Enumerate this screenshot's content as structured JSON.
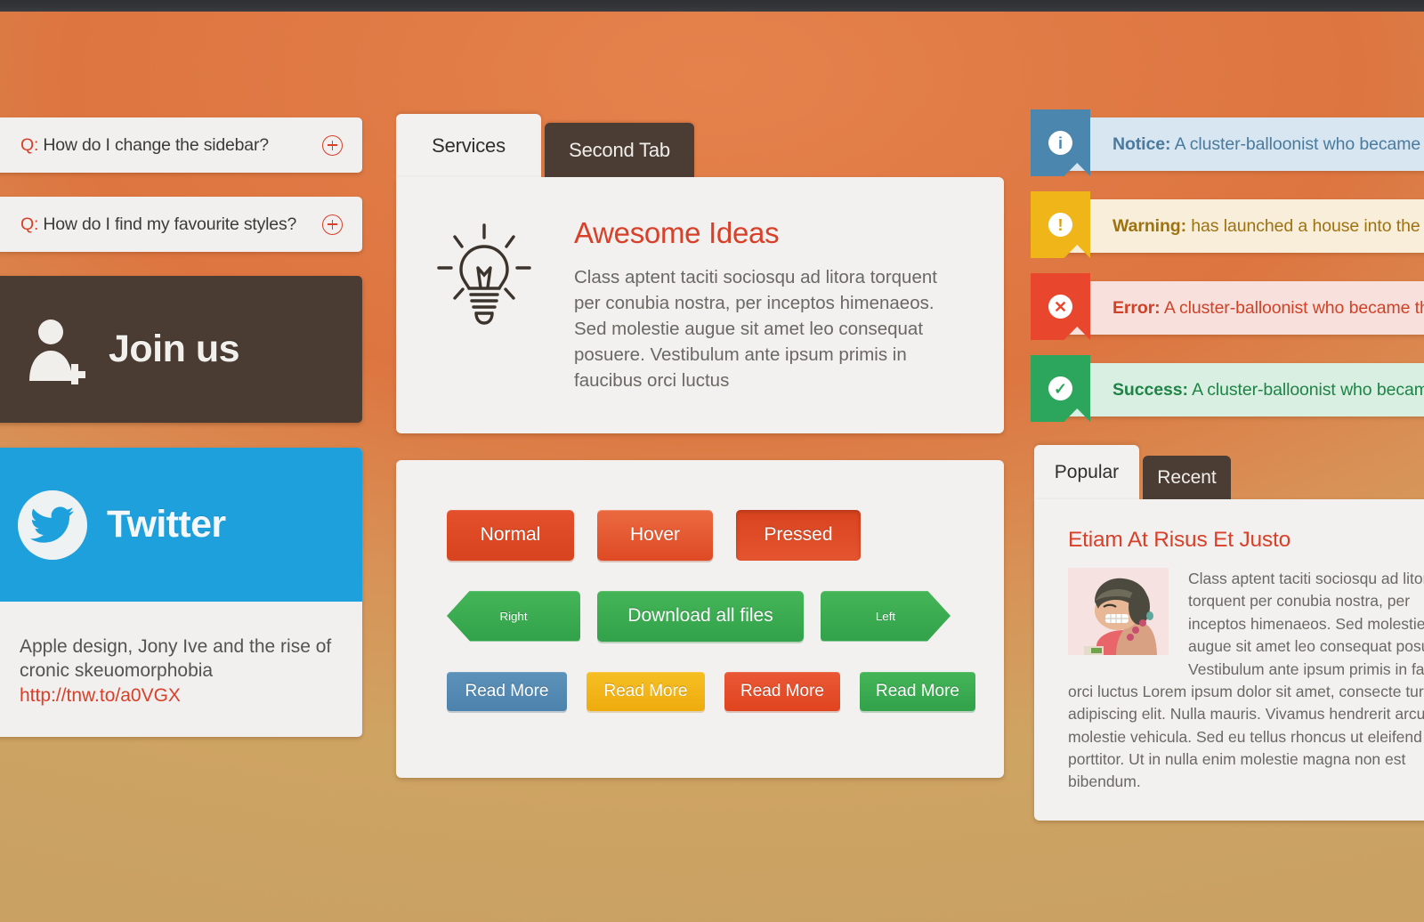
{
  "theme": {
    "accent_red": "#d8402a",
    "dark_brown": "#4a3c33",
    "twitter_blue": "#1da0dc",
    "panel_bg": "#f2f1ef",
    "blue": "#4a86ae",
    "yellow": "#f0b518",
    "red": "#e8472e",
    "green": "#2ca65c"
  },
  "faq": {
    "items": [
      {
        "prefix": "Q:",
        "question": " How do I change the sidebar?",
        "toggle_icon": "plus-circle-icon"
      },
      {
        "prefix": "Q:",
        "question": " How do I find my favourite styles?",
        "toggle_icon": "plus-circle-icon"
      }
    ]
  },
  "join_us": {
    "label": "Join us",
    "icon": "user-add-icon"
  },
  "twitter": {
    "label": "Twitter",
    "icon": "twitter-bird-icon",
    "tweet": "Apple design, Jony Ive and the rise of cronic skeuomorphobia",
    "link": "http://tnw.to/a0VGX"
  },
  "services": {
    "tabs": [
      {
        "label": "Services",
        "active": true
      },
      {
        "label": "Second Tab",
        "active": false
      }
    ],
    "icon": "lightbulb-icon",
    "title": "Awesome Ideas",
    "body": "Class aptent taciti sociosqu ad litora torquent per conubia nostra, per inceptos himenaeos. Sed molestie augue sit amet leo consequat posuere. Vestibulum ante ipsum primis in faucibus orci luctus"
  },
  "buttons": {
    "row1": [
      {
        "label": "Normal",
        "state": "normal",
        "color": "#d8431f"
      },
      {
        "label": "Hover",
        "state": "hover",
        "color": "#de4a24"
      },
      {
        "label": "Pressed",
        "state": "pressed",
        "color": "#d8431f"
      }
    ],
    "row2": [
      {
        "label": "Right",
        "shape": "arrow-left-ribbon",
        "color": "#32a24b"
      },
      {
        "label": "Download all files",
        "shape": "rounded",
        "color": "#32a24b"
      },
      {
        "label": "Left",
        "shape": "arrow-right-ribbon",
        "color": "#32a24b"
      }
    ],
    "row3": [
      {
        "label": "Read More",
        "color": "#4c82ac"
      },
      {
        "label": "Read More",
        "color": "#eeab0d"
      },
      {
        "label": "Read More",
        "color": "#e0441f"
      },
      {
        "label": "Read More",
        "color": "#32a24b"
      }
    ]
  },
  "alerts": [
    {
      "type": "notice",
      "icon": "info-icon",
      "glyph": "i",
      "title": "Notice:",
      "message": " A cluster-balloonist who became th"
    },
    {
      "type": "warning",
      "icon": "warning-icon",
      "glyph": "!",
      "title": "Warning:",
      "message": " has launched a house into the sky"
    },
    {
      "type": "error",
      "icon": "error-icon",
      "glyph": "✕",
      "title": "Error:",
      "message": " A cluster-balloonist who became the f"
    },
    {
      "type": "success",
      "icon": "check-icon",
      "glyph": "✓",
      "title": "Success:",
      "message": " A cluster-balloonist who became th"
    }
  ],
  "popular": {
    "tabs": [
      {
        "label": "Popular",
        "active": true
      },
      {
        "label": "Recent",
        "active": false
      }
    ],
    "post": {
      "title": "Etiam At Risus Et Justo",
      "thumbnail": "caricature-woman-avatar",
      "text": "Class aptent taciti sociosqu ad litora torquent per conubia nostra, per inceptos himenaeos. Sed molestie augue sit amet leo consequat posuere. Vestibulum ante ipsum primis in faucibus orci luctus Lorem ipsum dolor sit amet, consecte tur adipiscing elit. Nulla mauris. Vivamus hendrerit arcud erat molestie vehicula. Sed eu tellus rhoncus ut eleifend nibh porttitor. Ut in nulla enim molestie magna non est bibendum."
    }
  }
}
